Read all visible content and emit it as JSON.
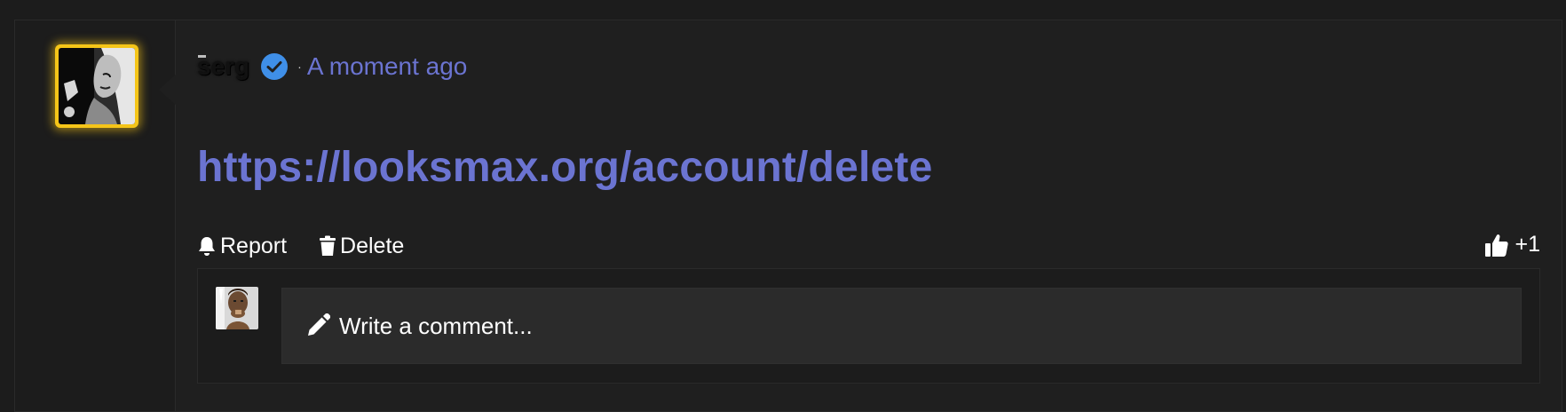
{
  "post": {
    "author": {
      "name": "serg",
      "verified": true,
      "avatar_border_color": "#f5c518"
    },
    "separator": "·",
    "timestamp": "A moment ago",
    "link_text": "https://looksmax.org/account/delete",
    "actions": {
      "report_label": "Report",
      "delete_label": "Delete",
      "like_label": "+1"
    },
    "comment": {
      "placeholder": "Write a comment..."
    }
  },
  "colors": {
    "accent": "#6b74d1",
    "verified": "#3f8fe8",
    "background": "#1f1f1f"
  },
  "icons": {
    "verified": "check-badge-icon",
    "report": "bell-icon",
    "delete": "trash-icon",
    "like": "thumbs-up-icon",
    "comment": "pencil-icon"
  }
}
